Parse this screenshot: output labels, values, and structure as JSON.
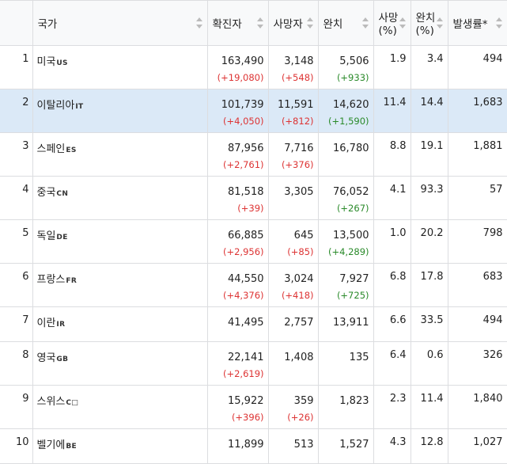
{
  "headers": {
    "rank": "",
    "country": "국가",
    "confirmed": "확진자",
    "deaths": "사망자",
    "recovered": "완치",
    "death_rate_1": "사망",
    "death_rate_2": "(%)",
    "recovery_rate_1": "완치",
    "recovery_rate_2": "(%)",
    "incidence": "발생률*"
  },
  "rows": [
    {
      "rank": "1",
      "country": "미국",
      "code": "US",
      "confirmed": "163,490",
      "confirmed_delta": "(+19,080)",
      "deaths": "3,148",
      "deaths_delta": "(+548)",
      "recovered": "5,506",
      "recovered_delta": "(+933)",
      "death_rate": "1.9",
      "recovery_rate": "3.4",
      "incidence": "494"
    },
    {
      "rank": "2",
      "country": "이탈리아",
      "code": "IT",
      "confirmed": "101,739",
      "confirmed_delta": "(+4,050)",
      "deaths": "11,591",
      "deaths_delta": "(+812)",
      "recovered": "14,620",
      "recovered_delta": "(+1,590)",
      "death_rate": "11.4",
      "recovery_rate": "14.4",
      "incidence": "1,683"
    },
    {
      "rank": "3",
      "country": "스페인",
      "code": "ES",
      "confirmed": "87,956",
      "confirmed_delta": "(+2,761)",
      "deaths": "7,716",
      "deaths_delta": "(+376)",
      "recovered": "16,780",
      "recovered_delta": "",
      "death_rate": "8.8",
      "recovery_rate": "19.1",
      "incidence": "1,881"
    },
    {
      "rank": "4",
      "country": "중국",
      "code": "CN",
      "confirmed": "81,518",
      "confirmed_delta": "(+39)",
      "deaths": "3,305",
      "deaths_delta": "",
      "recovered": "76,052",
      "recovered_delta": "(+267)",
      "death_rate": "4.1",
      "recovery_rate": "93.3",
      "incidence": "57"
    },
    {
      "rank": "5",
      "country": "독일",
      "code": "DE",
      "confirmed": "66,885",
      "confirmed_delta": "(+2,956)",
      "deaths": "645",
      "deaths_delta": "(+85)",
      "recovered": "13,500",
      "recovered_delta": "(+4,289)",
      "death_rate": "1.0",
      "recovery_rate": "20.2",
      "incidence": "798"
    },
    {
      "rank": "6",
      "country": "프랑스",
      "code": "FR",
      "confirmed": "44,550",
      "confirmed_delta": "(+4,376)",
      "deaths": "3,024",
      "deaths_delta": "(+418)",
      "recovered": "7,927",
      "recovered_delta": "(+725)",
      "death_rate": "6.8",
      "recovery_rate": "17.8",
      "incidence": "683"
    },
    {
      "rank": "7",
      "country": "이란",
      "code": "IR",
      "confirmed": "41,495",
      "confirmed_delta": "",
      "deaths": "2,757",
      "deaths_delta": "",
      "recovered": "13,911",
      "recovered_delta": "",
      "death_rate": "6.6",
      "recovery_rate": "33.5",
      "incidence": "494"
    },
    {
      "rank": "8",
      "country": "영국",
      "code": "GB",
      "confirmed": "22,141",
      "confirmed_delta": "(+2,619)",
      "deaths": "1,408",
      "deaths_delta": "",
      "recovered": "135",
      "recovered_delta": "",
      "death_rate": "6.4",
      "recovery_rate": "0.6",
      "incidence": "326"
    },
    {
      "rank": "9",
      "country": "스위스",
      "code": "C□",
      "confirmed": "15,922",
      "confirmed_delta": "(+396)",
      "deaths": "359",
      "deaths_delta": "(+26)",
      "recovered": "1,823",
      "recovered_delta": "",
      "death_rate": "2.3",
      "recovery_rate": "11.4",
      "incidence": "1,840"
    },
    {
      "rank": "10",
      "country": "벨기에",
      "code": "BE",
      "confirmed": "11,899",
      "confirmed_delta": "",
      "deaths": "513",
      "deaths_delta": "",
      "recovered": "1,527",
      "recovered_delta": "",
      "death_rate": "4.3",
      "recovery_rate": "12.8",
      "incidence": "1,027"
    }
  ],
  "highlight_color": "#dbe9f7",
  "increase_color": "#dd3333",
  "recovered_color": "#2a8a2a"
}
